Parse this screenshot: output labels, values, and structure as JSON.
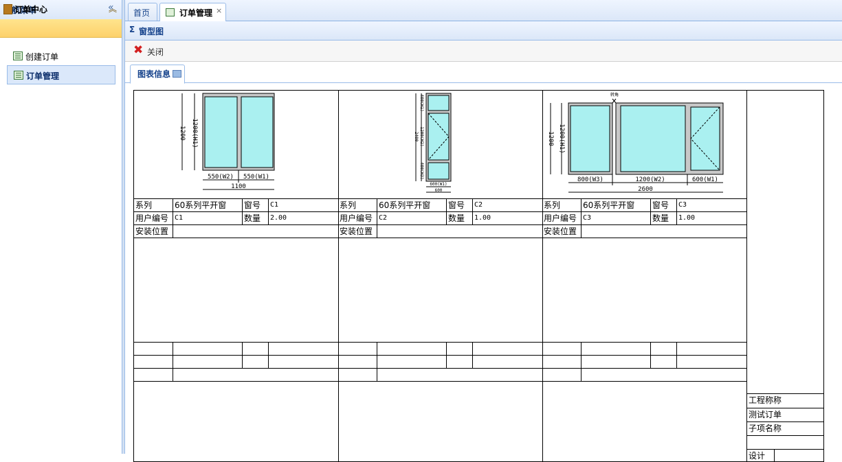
{
  "sidebar": {
    "title": "导航菜单",
    "collapse_icon": "«",
    "group": {
      "label": "订单中心",
      "toggle": "︽"
    },
    "items": [
      {
        "label": "创建订单"
      },
      {
        "label": "订单管理"
      }
    ]
  },
  "tabs": [
    {
      "label": "首页"
    },
    {
      "label": "订单管理",
      "close": "×"
    }
  ],
  "panel": {
    "title": "窗型图",
    "sigma": "Σ"
  },
  "toolbar": {
    "close_label": "关闭"
  },
  "inner_tab": {
    "label": "图表信息"
  },
  "windows": [
    {
      "fields": {
        "series_label": "系列",
        "series": "60系列平开窗",
        "no_label": "窗号",
        "no": "C1",
        "user_code_label": "用户编号",
        "user_code": "C1",
        "qty_label": "数量",
        "qty": "2.00",
        "location_label": "安装位置",
        "location": ""
      },
      "dims": {
        "height_total": "1200",
        "height_h1": "1200(H1)",
        "w2": "550(W2)",
        "w1": "550(W1)",
        "width_total": "1100"
      }
    },
    {
      "fields": {
        "series_label": "系列",
        "series": "60系列平开窗",
        "no_label": "窗号",
        "no": "C2",
        "user_code_label": "用户编号",
        "user_code": "C2",
        "qty_label": "数量",
        "qty": "1.00",
        "location_label": "安装位置",
        "location": ""
      },
      "dims": {
        "height_total": "2400",
        "h1": "400(H1)",
        "h2": "1200(H2)",
        "h3": "400(H3)",
        "w1": "600(W1)",
        "width_total": "600"
      }
    },
    {
      "fields": {
        "series_label": "系列",
        "series": "60系列平开窗",
        "no_label": "窗号",
        "no": "C3",
        "user_code_label": "用户编号",
        "user_code": "C3",
        "qty_label": "数量",
        "qty": "1.00",
        "location_label": "安装位置",
        "location": ""
      },
      "dims": {
        "height_total": "1200",
        "height_h1": "1200(H1)",
        "w3": "800(W3)",
        "w2": "1200(W2)",
        "w1": "600(W1)",
        "width_total": "2600",
        "mullion": "转角"
      }
    }
  ],
  "title_block": {
    "project_label": "工程称称",
    "project_value": "测试订单",
    "subitem_label": "子项名称",
    "design_label": "设计"
  }
}
